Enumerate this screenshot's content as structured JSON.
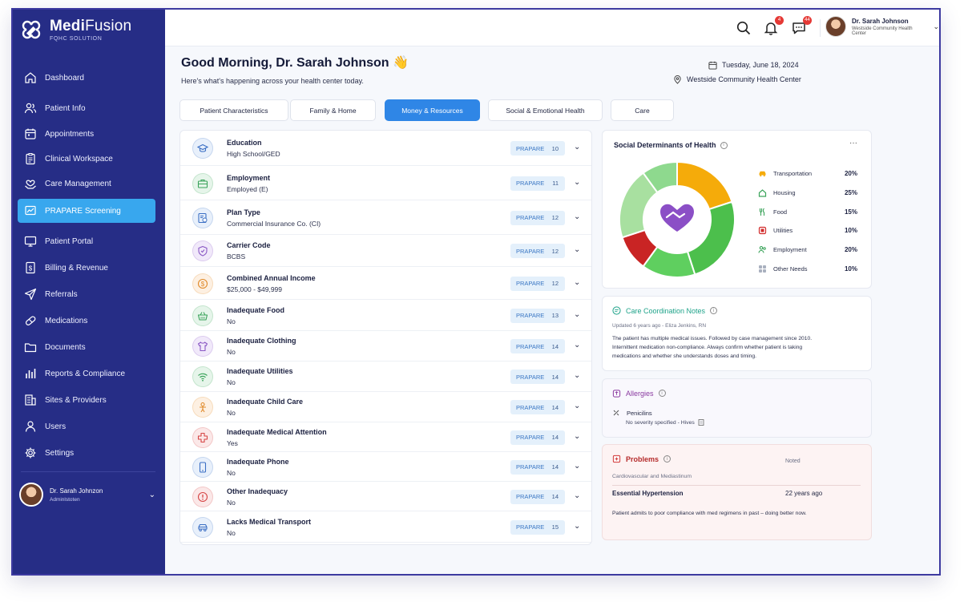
{
  "brand": {
    "name_bold": "Medi",
    "name_light": "Fusion",
    "subtitle": "FQHC SOLUTION"
  },
  "sidebar": {
    "items": [
      {
        "label": "Dashboard",
        "icon": "home-icon",
        "active": false
      },
      {
        "label": "Patient Info",
        "icon": "users-icon",
        "active": false
      },
      {
        "label": "Appointments",
        "icon": "calendar-icon",
        "active": false
      },
      {
        "label": "Clinical Workspace",
        "icon": "clipboard-icon",
        "active": false
      },
      {
        "label": "Care Management",
        "icon": "hand-heart-icon",
        "active": false
      },
      {
        "label": "PRAPARE Screening",
        "icon": "chart-screen-icon",
        "active": true
      },
      {
        "label": "Patient Portal",
        "icon": "monitor-icon",
        "active": false
      },
      {
        "label": "Billing & Revenue",
        "icon": "dollar-doc-icon",
        "active": false
      },
      {
        "label": "Referrals",
        "icon": "send-icon",
        "active": false
      },
      {
        "label": "Medications",
        "icon": "pill-icon",
        "active": false
      },
      {
        "label": "Documents",
        "icon": "folder-icon",
        "active": false
      },
      {
        "label": "Reports & Compliance",
        "icon": "bar-chart-icon",
        "active": false
      },
      {
        "label": "Sites & Providers",
        "icon": "building-icon",
        "active": false
      },
      {
        "label": "Users",
        "icon": "user-icon",
        "active": false
      },
      {
        "label": "Settings",
        "icon": "gear-icon",
        "active": false
      }
    ],
    "user": {
      "name": "Dr. Sarah Johnzon",
      "role": "Adminlstoten"
    }
  },
  "header": {
    "notifications_count": "4",
    "messages_count": "44",
    "user_name": "Dr. Sarah Johnson",
    "user_org": "Westside Community Health Center"
  },
  "greeting": {
    "title": "Good Morning, Dr. Sarah Johnson 👋",
    "subtitle": "Here's what's happening across your health center today.",
    "date": "Tuesday, June 18, 2024",
    "location": "Westside Community Health Center"
  },
  "tabs": [
    {
      "label": "Patient Characteristics",
      "active": false
    },
    {
      "label": "Family & Home",
      "active": false
    },
    {
      "label": "Money & Resources",
      "active": true
    },
    {
      "label": "Social & Emotional Health",
      "active": false
    },
    {
      "label": "Care",
      "active": false
    }
  ],
  "rows": [
    {
      "title": "Education",
      "value": "High School/GED",
      "tag": "PRAPARE",
      "num": "10",
      "icon": "graduation-cap-icon",
      "color": "#3b6fc4",
      "bg": "#e8f0fb"
    },
    {
      "title": "Employment",
      "value": "Employed (E)",
      "tag": "PRAPARE",
      "num": "11",
      "icon": "briefcase-icon",
      "color": "#3aa35a",
      "bg": "#e6f5ea"
    },
    {
      "title": "Plan Type",
      "value": "Commercial Insurance Co. (CI)",
      "tag": "PRAPARE",
      "num": "12",
      "icon": "insurance-card-icon",
      "color": "#3b6fc4",
      "bg": "#e8f0fb"
    },
    {
      "title": "Carrier Code",
      "value": "BCBS",
      "tag": "PRAPARE",
      "num": "12",
      "icon": "shield-icon",
      "color": "#8a58c4",
      "bg": "#f1e9fa"
    },
    {
      "title": "Combined Annual Income",
      "value": "$25,000 - $49,999",
      "tag": "PRAPARE",
      "num": "12",
      "icon": "dollar-coin-icon",
      "color": "#e08a2a",
      "bg": "#fdf0e2"
    },
    {
      "title": "Inadequate Food",
      "value": "No",
      "tag": "PRAPARE",
      "num": "13",
      "icon": "basket-icon",
      "color": "#3aa35a",
      "bg": "#e6f5ea"
    },
    {
      "title": "Inadequate Clothing",
      "value": "No",
      "tag": "PRAPARE",
      "num": "14",
      "icon": "shirt-icon",
      "color": "#8a58c4",
      "bg": "#f1e9fa"
    },
    {
      "title": "Inadequate Utilities",
      "value": "No",
      "tag": "PRAPARE",
      "num": "14",
      "icon": "wifi-icon",
      "color": "#3aa35a",
      "bg": "#e6f5ea"
    },
    {
      "title": "Inadequate Child Care",
      "value": "No",
      "tag": "PRAPARE",
      "num": "14",
      "icon": "child-icon",
      "color": "#e08a2a",
      "bg": "#fdf0e2"
    },
    {
      "title": "Inadequate Medical Attention",
      "value": "Yes",
      "tag": "PRAPARE",
      "num": "14",
      "icon": "medical-cross-icon",
      "color": "#d64545",
      "bg": "#fbe8e8"
    },
    {
      "title": "Inadequate Phone",
      "value": "No",
      "tag": "PRAPARE",
      "num": "14",
      "icon": "phone-icon",
      "color": "#3b6fc4",
      "bg": "#e8f0fb"
    },
    {
      "title": "Other Inadequacy",
      "value": "No",
      "tag": "PRAPARE",
      "num": "14",
      "icon": "alert-circle-icon",
      "color": "#d64545",
      "bg": "#fbe8e8"
    },
    {
      "title": "Lacks Medical Transport",
      "value": "No",
      "tag": "PRAPARE",
      "num": "15",
      "icon": "car-icon",
      "color": "#3b6fc4",
      "bg": "#e8f0fb"
    }
  ],
  "sdoh": {
    "title": "Social Determinants of Health",
    "legend": [
      {
        "label": "Transportation",
        "pct": "20%",
        "icon": "car-icon",
        "color": "#f5ab0a"
      },
      {
        "label": "Housing",
        "pct": "25%",
        "icon": "house-icon",
        "color": "#3aa35a"
      },
      {
        "label": "Food",
        "pct": "15%",
        "icon": "fork-knife-icon",
        "color": "#3aa35a"
      },
      {
        "label": "Utilities",
        "pct": "10%",
        "icon": "plug-icon",
        "color": "#d12b2b"
      },
      {
        "label": "Employment",
        "pct": "20%",
        "icon": "people-icon",
        "color": "#3aa35a"
      },
      {
        "label": "Other Needs",
        "pct": "10%",
        "icon": "grid-icon",
        "color": "#a9b0bf"
      }
    ]
  },
  "chart_data": {
    "type": "pie",
    "categories": [
      "Transportation",
      "Housing",
      "Food",
      "Utilities",
      "Employment",
      "Other Needs"
    ],
    "values": [
      20,
      25,
      15,
      10,
      20,
      10
    ],
    "colors": [
      "#f5ab0a",
      "#4cbf4c",
      "#5fcf5f",
      "#c92424",
      "#a8e0a0",
      "#8ed98e"
    ],
    "title": "Social Determinants of Health"
  },
  "care_notes": {
    "title": "Care Coordination Notes",
    "updated": "Updated 6 years ago - Eliza Jenkins, RN",
    "body": "The patient has multiple medical issues. Followed by case management since 2010. Internittent medication non-compliance. Always confirm whether patient is taking medications and whether she understands doses and timing."
  },
  "allergies": {
    "title": "Allergies",
    "item": "Penicilins",
    "severity": "No severity specified - Hives"
  },
  "problems": {
    "title": "Problems",
    "noted_label": "Noted",
    "system": "Cardiovascular and Mediastinum",
    "diagnosis": "Essential Hypertension",
    "noted_ago": "22 years ago",
    "note": "Patient admits to poor compliance with med regimens in past – doing better now."
  }
}
